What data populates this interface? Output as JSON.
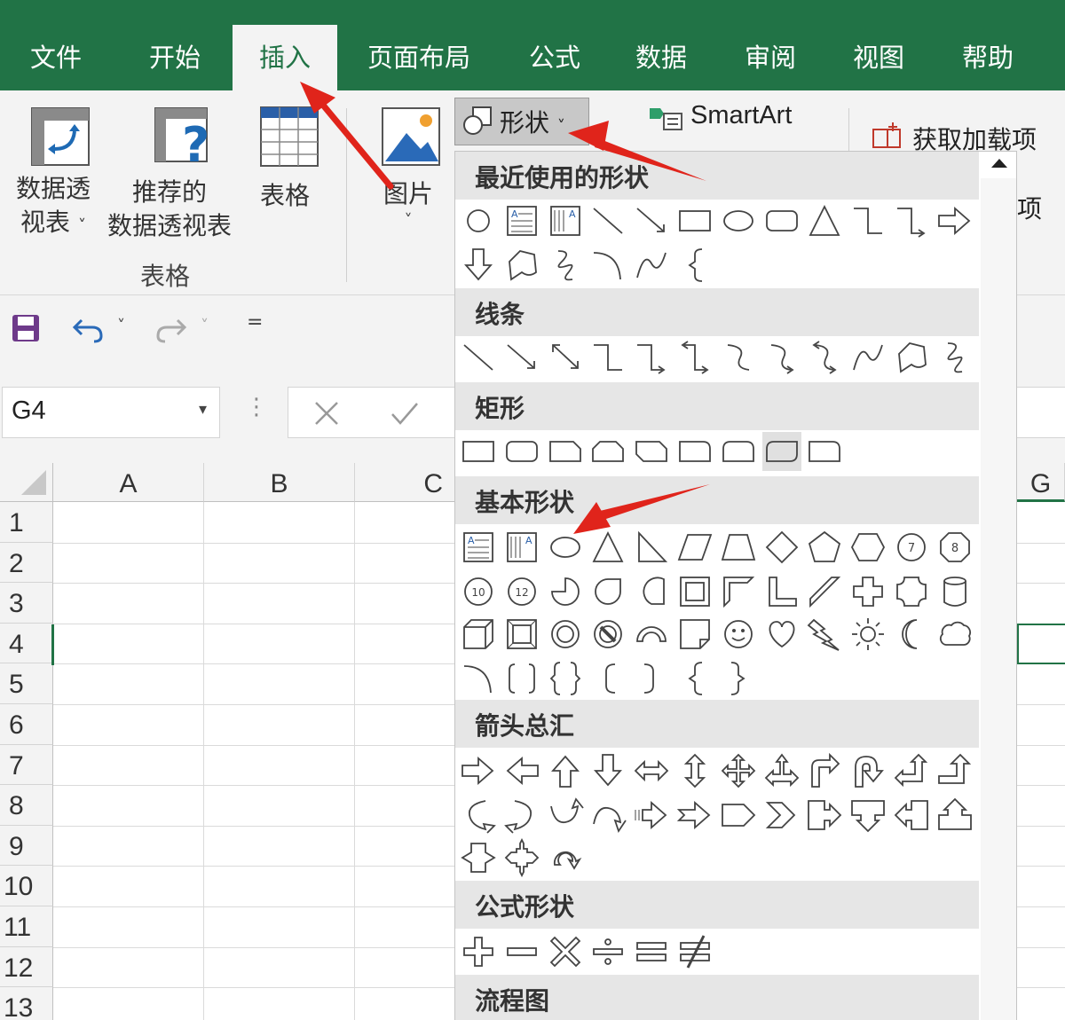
{
  "tabs": [
    {
      "label": "文件",
      "active": false
    },
    {
      "label": "开始",
      "active": false
    },
    {
      "label": "插入",
      "active": true
    },
    {
      "label": "页面布局",
      "active": false
    },
    {
      "label": "公式",
      "active": false
    },
    {
      "label": "数据",
      "active": false
    },
    {
      "label": "审阅",
      "active": false
    },
    {
      "label": "视图",
      "active": false
    },
    {
      "label": "帮助",
      "active": false
    }
  ],
  "ribbon": {
    "pivot_table": {
      "line1": "数据透",
      "line2": "视表",
      "chevron": "˅"
    },
    "recommended_pivot": {
      "line1": "推荐的",
      "line2": "数据透视表"
    },
    "table": {
      "label": "表格"
    },
    "group_label": "表格",
    "picture": {
      "label": "图片",
      "chevron": "˅"
    },
    "shapes": {
      "label": "形状",
      "chevron": "˅"
    },
    "smartart": {
      "label": "SmartArt"
    },
    "addins": {
      "label": "获取加载项",
      "label2": "项"
    }
  },
  "quick_access": {
    "chevron1": "˅",
    "chevron2": "˅",
    "more": "="
  },
  "formula_bar": {
    "name_box": "G4",
    "name_box_chevron": "▾",
    "dots": "⋮"
  },
  "columns": [
    "A",
    "B",
    "C",
    "G"
  ],
  "rows": [
    "1",
    "2",
    "3",
    "4",
    "5",
    "6",
    "7",
    "8",
    "9",
    "10",
    "11",
    "12",
    "13"
  ],
  "shapes_menu": {
    "sections": [
      {
        "label": "最近使用的形状"
      },
      {
        "label": "线条"
      },
      {
        "label": "矩形"
      },
      {
        "label": "基本形状"
      },
      {
        "label": "箭头总汇"
      },
      {
        "label": "公式形状"
      },
      {
        "label": "流程图"
      }
    ],
    "circle_numbers": [
      "10",
      "12",
      "7",
      "8"
    ]
  },
  "colors": {
    "accent": "#217346",
    "annotation_arrow": "#e0241b"
  }
}
